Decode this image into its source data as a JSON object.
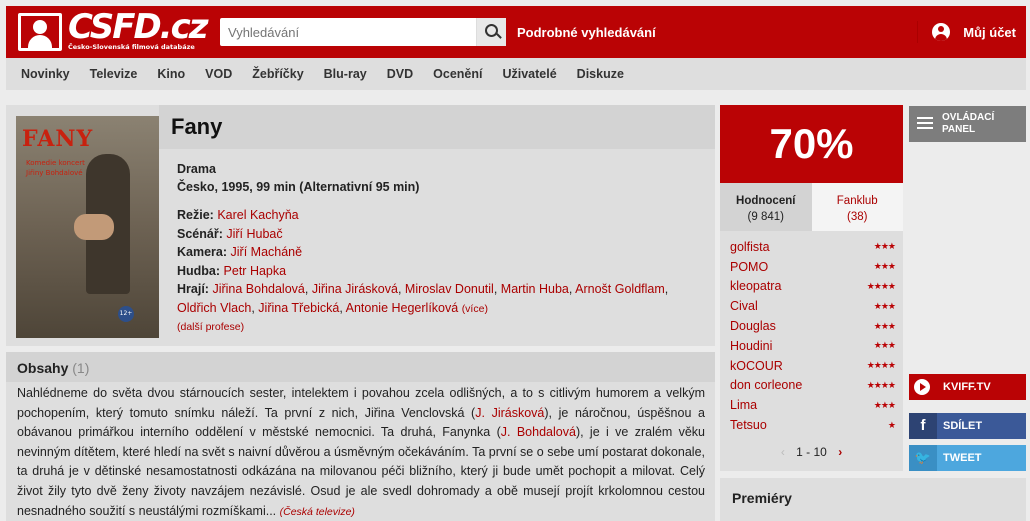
{
  "header": {
    "logo_text": "CSFD.cz",
    "logo_subtitle": "Česko-Slovenská filmová databáze",
    "search_placeholder": "Vyhledávání",
    "advanced_search": "Podrobné vyhledávání",
    "account": "Můj účet"
  },
  "nav": [
    "Novinky",
    "Televize",
    "Kino",
    "VOD",
    "Žebříčky",
    "Blu-ray",
    "DVD",
    "Ocenění",
    "Uživatelé",
    "Diskuze"
  ],
  "film": {
    "title": "Fany",
    "genre": "Drama",
    "origin": "Česko, 1995, 99 min (Alternativní 95 min)",
    "poster": {
      "title": "FANY",
      "subtitle": "Komedie koncert Jiřiny Bohdalové"
    },
    "creators": {
      "directing_label": "Režie:",
      "directing": "Karel Kachyňa",
      "screenplay_label": "Scénář:",
      "screenplay": "Jiří Hubač",
      "camera_label": "Kamera:",
      "camera": "Jiří Macháně",
      "music_label": "Hudba:",
      "music": "Petr Hapka",
      "cast_label": "Hrají:",
      "cast": [
        "Jiřina Bohdalová",
        "Jiřina Jirásková",
        "Miroslav Donutil",
        "Martin Huba",
        "Arnošt Goldflam",
        "Oldřich Vlach",
        "Jiřina Třebická",
        "Antonie Hegerlíková"
      ],
      "more": "(více)",
      "more_professions": "(další profese)"
    }
  },
  "plot": {
    "title": "Obsahy",
    "count": "(1)",
    "part1": "Nahlédneme do světa dvou stárnoucích sester, intelektem i povahou zcela odlišných, a to s citlivým humorem a velkým pochopením, který tomuto snímku náleží. Ta první z nich, Jiřina Venclovská (",
    "link1": "J. Jirásková",
    "part2": "), je náročnou, úspěšnou a obávanou primářkou interního oddělení v městské nemocnici. Ta druhá, Fanynka (",
    "link2": "J. Bohdalová",
    "part3": "), je i ve zralém věku nevinným dítětem, které hledí na svět s naivní důvěrou a úsměvným očekáváním. Ta první se o sebe umí postarat dokonale, ta druhá je v dětinské nesamostatnosti odkázána na milovanou péči bližního, který ji bude umět pochopit a milovat. Celý život žily tyto dvě ženy životy navzájem nezávislé. Osud je ale svedl dohromady a obě musejí projít krkolomnou cestou nesnadného soužití s neustálými rozmíškami...",
    "source": "(Česká televize)"
  },
  "rating": {
    "percent": "70%",
    "tab_ratings": "Hodnocení",
    "tab_ratings_count": "(9 841)",
    "tab_fanclub": "Fanklub",
    "tab_fanclub_count": "(38)",
    "users": [
      {
        "name": "golfista",
        "stars": "★★★"
      },
      {
        "name": "POMO",
        "stars": "★★★"
      },
      {
        "name": "kleopatra",
        "stars": "★★★★"
      },
      {
        "name": "Cival",
        "stars": "★★★"
      },
      {
        "name": "Douglas",
        "stars": "★★★"
      },
      {
        "name": "Houdini",
        "stars": "★★★"
      },
      {
        "name": "kOCOUR",
        "stars": "★★★★"
      },
      {
        "name": "don corleone",
        "stars": "★★★★"
      },
      {
        "name": "Lima",
        "stars": "★★★"
      },
      {
        "name": "Tetsuo",
        "stars": "★"
      }
    ],
    "pager": "1 - 10",
    "pager_prev": "‹",
    "pager_next": "›"
  },
  "sidebar": {
    "control_panel": "OVLÁDACÍ PANEL",
    "kviff": "KVIFF.TV",
    "share": "SDÍLET",
    "share_icon": "f",
    "tweet": "TWEET",
    "tweet_icon": "🐦"
  },
  "premiery": "Premiéry"
}
